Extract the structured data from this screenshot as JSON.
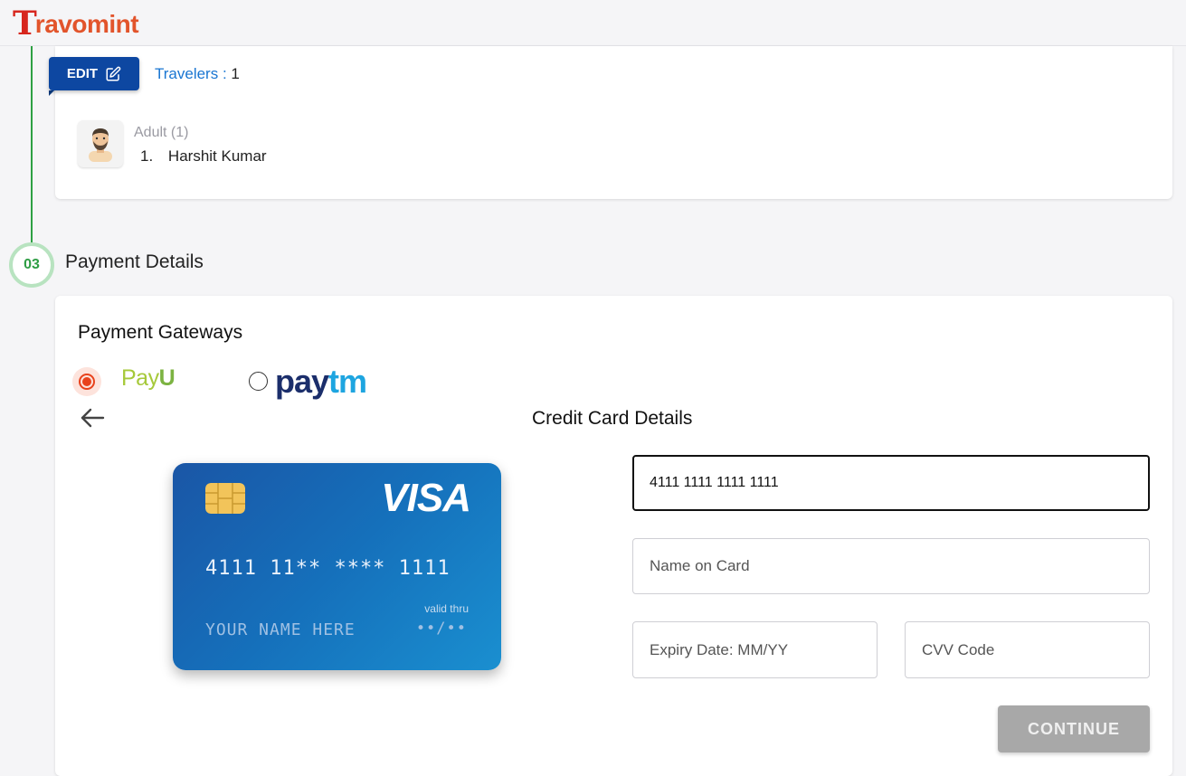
{
  "brand": {
    "logo_initial": "T",
    "logo_rest": "ravomint"
  },
  "travelers": {
    "edit_label": "EDIT",
    "label": "Travelers :",
    "count": "1",
    "adult_label": "Adult (1)",
    "list": [
      {
        "index": "1.",
        "name": "Harshit Kumar"
      }
    ]
  },
  "payment": {
    "step_number": "03",
    "step_title": "Payment Details",
    "gateways_title": "Payment Gateways",
    "gateways": [
      {
        "name": "PayU",
        "selected": true
      },
      {
        "name": "Paytm",
        "selected": false
      }
    ],
    "payu_logo": {
      "pay": "Pay",
      "u": "U"
    },
    "paytm_logo": {
      "pay": "pay",
      "tm": "tm"
    },
    "section_title": "Credit Card Details",
    "card_preview": {
      "brand": "VISA",
      "number": "4111 11** **** 1111",
      "valid_thru_label": "valid thru",
      "name": "YOUR NAME HERE",
      "expiry": "••/••"
    },
    "fields": {
      "card_number_value": "4111 1111 1111 1111",
      "name_placeholder": "Name on Card",
      "expiry_placeholder": "Expiry Date: MM/YY",
      "cvv_placeholder": "CVV Code"
    },
    "continue_label": "CONTINUE"
  },
  "colors": {
    "primary_blue": "#0d47a1",
    "link_blue": "#1976d2",
    "brand_red": "#d7261e",
    "step_green": "#2e9d44",
    "radio_orange": "#e8421c",
    "disabled_gray": "#a8a8a8"
  }
}
